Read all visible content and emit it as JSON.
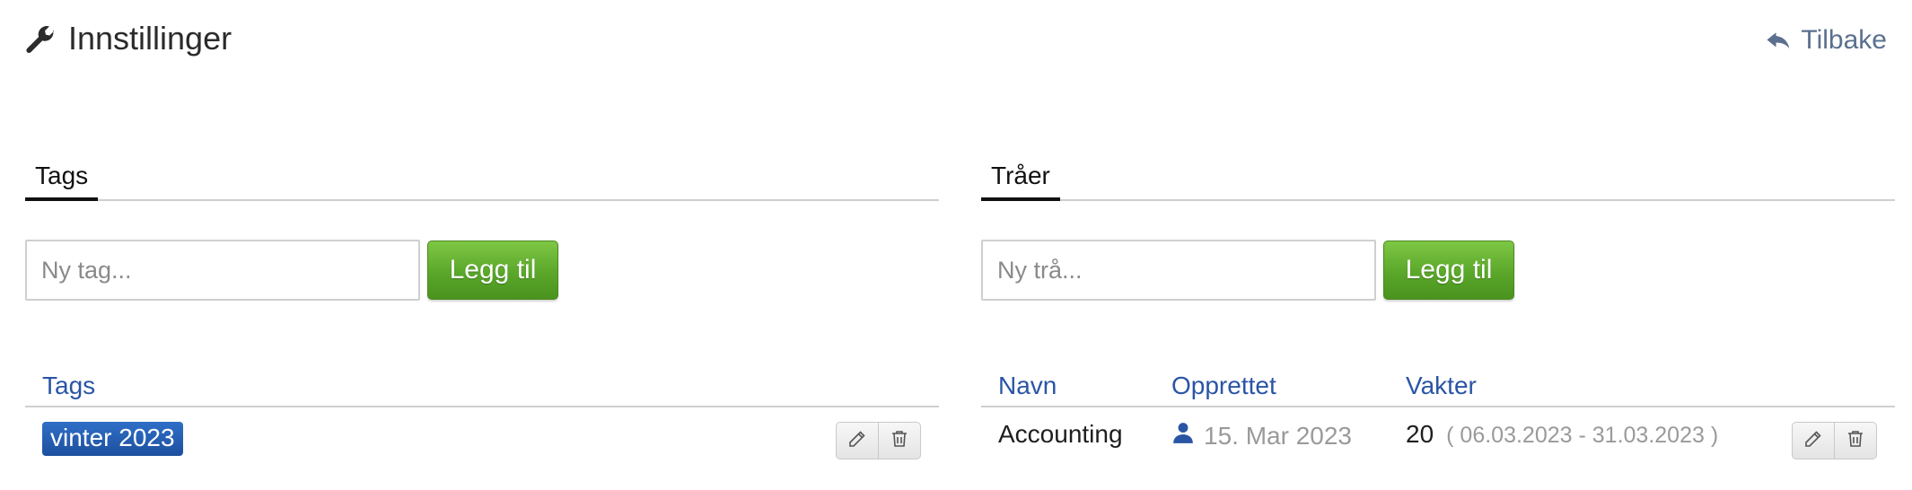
{
  "header": {
    "title": "Innstillinger",
    "back_label": "Tilbake"
  },
  "tags_panel": {
    "tab_label": "Tags",
    "input_placeholder": "Ny tag...",
    "add_button": "Legg til",
    "table": {
      "columns": [
        "Tags"
      ],
      "rows": [
        {
          "tag": "vinter 2023"
        }
      ]
    }
  },
  "threads_panel": {
    "tab_label": "Tråer",
    "input_placeholder": "Ny trå...",
    "add_button": "Legg til",
    "table": {
      "columns": [
        "Navn",
        "Opprettet",
        "Vakter"
      ],
      "rows": [
        {
          "name": "Accounting",
          "created": "15. Mar 2023",
          "shifts": "20",
          "range": "( 06.03.2023 - 31.03.2023 )"
        }
      ]
    }
  },
  "icons": {
    "title": "wrench-icon",
    "back": "reply-arrow-icon",
    "edit": "pencil-icon",
    "delete": "trash-icon",
    "creator": "user-icon"
  },
  "colors": {
    "accent_link": "#2a55a5",
    "tag_pill": "#1f56ad",
    "add_button": "#5aa72a",
    "back_link": "#5b6f8f"
  }
}
